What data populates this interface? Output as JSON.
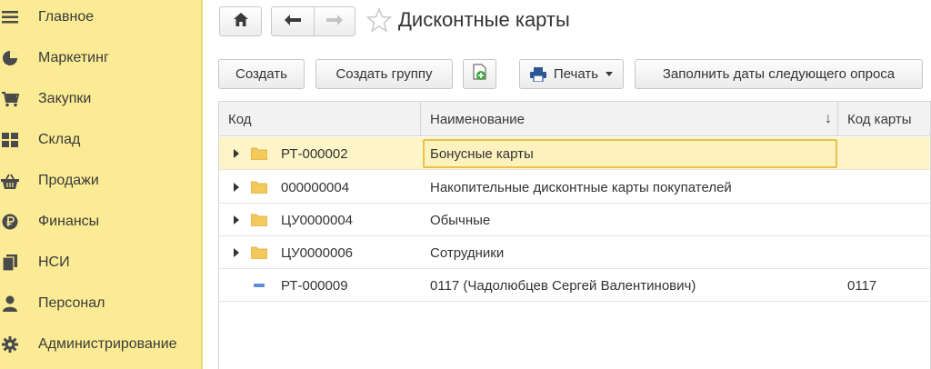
{
  "sidebar": {
    "items": [
      {
        "label": "Главное",
        "icon": "hamburger-menu-icon"
      },
      {
        "label": "Маркетинг",
        "icon": "pie-chart-icon"
      },
      {
        "label": "Закупки",
        "icon": "cart-icon"
      },
      {
        "label": "Склад",
        "icon": "warehouse-grid-icon"
      },
      {
        "label": "Продажи",
        "icon": "basket-icon"
      },
      {
        "label": "Финансы",
        "icon": "ruble-coin-icon"
      },
      {
        "label": "НСИ",
        "icon": "book-stack-icon"
      },
      {
        "label": "Персонал",
        "icon": "person-icon"
      },
      {
        "label": "Администрирование",
        "icon": "gear-icon"
      }
    ]
  },
  "header": {
    "title": "Дисконтные карты"
  },
  "toolbar": {
    "create": "Создать",
    "create_group": "Создать группу",
    "print": "Печать",
    "fill_dates": "Заполнить даты следующего опроса"
  },
  "table": {
    "columns": [
      "Код",
      "Наименование",
      "Код карты"
    ],
    "sort_indicator": "↓",
    "rows": [
      {
        "code": "РТ-000002",
        "name": "Бонусные карты",
        "card_code": "",
        "type": "group",
        "selected": true
      },
      {
        "code": "000000004",
        "name": "Накопительные дисконтные карты покупателей",
        "card_code": "",
        "type": "group",
        "selected": false
      },
      {
        "code": "ЦУ0000004",
        "name": "Обычные",
        "card_code": "",
        "type": "group",
        "selected": false
      },
      {
        "code": "ЦУ0000006",
        "name": "Сотрудники",
        "card_code": "",
        "type": "group",
        "selected": false
      },
      {
        "code": "РТ-000009",
        "name": "0117 (Чадолюбцев Сергей Валентинович)",
        "card_code": "0117",
        "type": "item",
        "selected": false
      }
    ]
  },
  "colors": {
    "sidebar_bg": "#fbeb94",
    "selected_row": "#fdf4c7",
    "folder": "#f2c95a",
    "accent_green": "#3aa53a"
  }
}
